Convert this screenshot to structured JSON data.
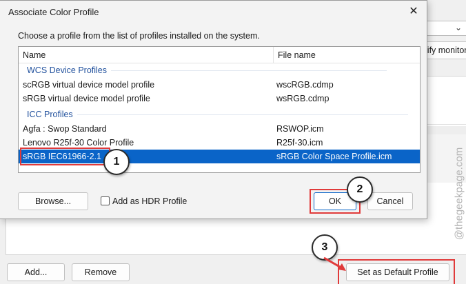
{
  "background": {
    "monitors_button_label": "Identify monitors",
    "add_label": "Add...",
    "remove_label": "Remove",
    "set_default_label": "Set as Default Profile"
  },
  "dialog": {
    "title": "Associate Color Profile",
    "close_glyph": "✕",
    "instruction": "Choose a profile from the list of profiles installed on the system.",
    "columns": {
      "name": "Name",
      "file": "File name"
    },
    "groups": [
      {
        "label": "WCS Device Profiles",
        "rows": [
          {
            "name": "scRGB virtual device model profile",
            "file": "wscRGB.cdmp"
          },
          {
            "name": "sRGB virtual device model profile",
            "file": "wsRGB.cdmp"
          }
        ]
      },
      {
        "label": "ICC Profiles",
        "rows": [
          {
            "name": "Agfa : Swop Standard",
            "file": "RSWOP.icm"
          },
          {
            "name": "Lenovo R25f-30 Color Profile",
            "file": "R25f-30.icm"
          },
          {
            "name": "sRGB IEC61966-2.1",
            "file": "sRGB Color Space Profile.icm"
          }
        ]
      }
    ],
    "selected_row": "sRGB IEC61966-2.1",
    "browse_label": "Browse...",
    "hdr_checkbox_label": "Add as HDR Profile",
    "hdr_checked": false,
    "ok_label": "OK",
    "cancel_label": "Cancel"
  },
  "annotations": {
    "step1": "1",
    "step2": "2",
    "step3": "3"
  },
  "watermark": "@thegeekpage.com",
  "colors": {
    "selection": "#0a64c8",
    "highlight": "#e03a3a",
    "group_text": "#1f4f9c"
  }
}
